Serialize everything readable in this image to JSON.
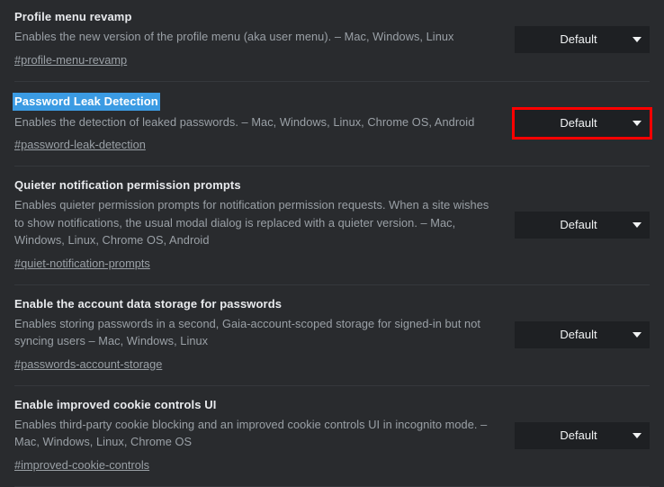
{
  "page": {
    "background_color": "#292b2e",
    "text_color": "#e8eaed",
    "description_color": "#9aa0a6",
    "selection_color": "#3b9be3",
    "highlight_color": "#ff0000"
  },
  "experiments": [
    {
      "title": "Profile menu revamp",
      "description": "Enables the new version of the profile menu (aka user menu). – Mac, Windows, Linux",
      "link": "#profile-menu-revamp",
      "select_value": "Default",
      "selected": false,
      "highlighted": false
    },
    {
      "title": "Password Leak Detection",
      "description": "Enables the detection of leaked passwords. – Mac, Windows, Linux, Chrome OS, Android",
      "link": "#password-leak-detection",
      "select_value": "Default",
      "selected": true,
      "highlighted": true
    },
    {
      "title": "Quieter notification permission prompts",
      "description": "Enables quieter permission prompts for notification permission requests. When a site wishes to show notifications, the usual modal dialog is replaced with a quieter version. – Mac, Windows, Linux, Chrome OS, Android",
      "link": "#quiet-notification-prompts",
      "select_value": "Default",
      "selected": false,
      "highlighted": false
    },
    {
      "title": "Enable the account data storage for passwords",
      "description": "Enables storing passwords in a second, Gaia-account-scoped storage for signed-in but not syncing users – Mac, Windows, Linux",
      "link": "#passwords-account-storage",
      "select_value": "Default",
      "selected": false,
      "highlighted": false
    },
    {
      "title": "Enable improved cookie controls UI",
      "description": "Enables third-party cookie blocking and an improved cookie controls UI in incognito mode. – Mac, Windows, Linux, Chrome OS",
      "link": "#improved-cookie-controls",
      "select_value": "Default",
      "selected": false,
      "highlighted": false
    }
  ],
  "icons": {
    "dropdown_arrow": "chevron-down-icon"
  }
}
